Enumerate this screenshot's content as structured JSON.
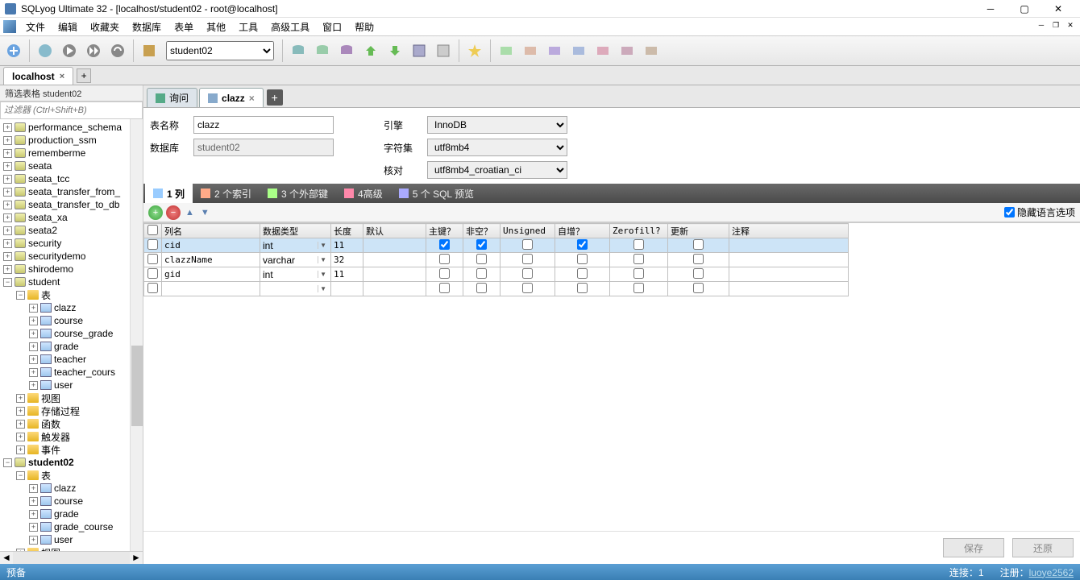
{
  "window_title": "SQLyog Ultimate 32 - [localhost/student02 - root@localhost]",
  "menubar": [
    "文件",
    "编辑",
    "收藏夹",
    "数据库",
    "表单",
    "其他",
    "工具",
    "高级工具",
    "窗口",
    "帮助"
  ],
  "toolbar_db_selected": "student02",
  "conn_tab": {
    "label": "localhost"
  },
  "sidebar": {
    "filter_title": "筛选表格 student02",
    "filter_placeholder": "过滤器 (Ctrl+Shift+B)",
    "dbs_closed": [
      "performance_schema",
      "production_ssm",
      "rememberme",
      "seata",
      "seata_tcc",
      "seata_transfer_from_",
      "seata_transfer_to_db",
      "seata_xa",
      "seata2",
      "security",
      "securitydemo",
      "shirodemo"
    ],
    "student": {
      "name": "student",
      "tables_label": "表",
      "tables": [
        "clazz",
        "course",
        "course_grade",
        "grade",
        "teacher",
        "teacher_cours",
        "user"
      ],
      "folders": [
        "视图",
        "存储过程",
        "函数",
        "触发器",
        "事件"
      ]
    },
    "student02": {
      "name": "student02",
      "tables_label": "表",
      "tables": [
        "clazz",
        "course",
        "grade",
        "grade_course",
        "user"
      ],
      "folders": [
        "视图"
      ]
    }
  },
  "tabs": [
    {
      "label": "询问",
      "active": false
    },
    {
      "label": "clazz",
      "active": true
    }
  ],
  "form": {
    "name_label": "表名称",
    "name_value": "clazz",
    "db_label": "数据库",
    "db_value": "student02",
    "engine_label": "引擎",
    "engine_value": "InnoDB",
    "charset_label": "字符集",
    "charset_value": "utf8mb4",
    "collate_label": "核对",
    "collate_value": "utf8mb4_croatian_ci"
  },
  "inner_tabs": [
    {
      "label": "1 列",
      "active": true
    },
    {
      "label": "2 个索引",
      "active": false
    },
    {
      "label": "3 个外部键",
      "active": false
    },
    {
      "label": "4高级",
      "active": false
    },
    {
      "label": "5 个 SQL 预览",
      "active": false
    }
  ],
  "hide_lang_label": "隐藏语言选项",
  "grid_headers": [
    "列名",
    "数据类型",
    "长度",
    "默认",
    "主键？",
    "非空？",
    "Unsigned",
    "自增？",
    "Zerofill?",
    "更新",
    "注释"
  ],
  "rows": [
    {
      "name": "cid",
      "type": "int",
      "len": "11",
      "def": "",
      "pk": true,
      "nn": true,
      "us": false,
      "ai": true,
      "zf": false,
      "up": false,
      "cm": "",
      "sel": true
    },
    {
      "name": "clazzName",
      "type": "varchar",
      "len": "32",
      "def": "",
      "pk": false,
      "nn": false,
      "us": false,
      "ai": false,
      "zf": false,
      "up": false,
      "cm": "",
      "sel": false
    },
    {
      "name": "gid",
      "type": "int",
      "len": "11",
      "def": "",
      "pk": false,
      "nn": false,
      "us": false,
      "ai": false,
      "zf": false,
      "up": false,
      "cm": "",
      "sel": false
    }
  ],
  "buttons": {
    "save": "保存",
    "revert": "还原"
  },
  "status": {
    "left": "预备",
    "conn": "连接：1",
    "reg_label": "注册：",
    "reg_user": "luoye2562"
  }
}
